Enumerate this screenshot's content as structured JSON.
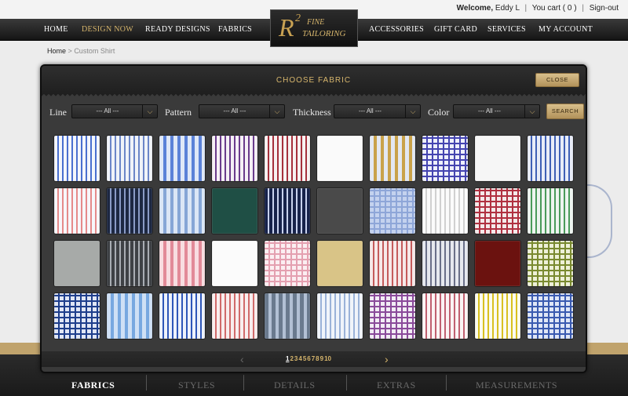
{
  "header": {
    "welcome": "Welcome,",
    "user_name": "Eddy L",
    "separator": "|",
    "cart_label": "You cart",
    "cart_count": "( 0 )",
    "signout": "Sign-out"
  },
  "nav": {
    "items": [
      {
        "label": "HOME"
      },
      {
        "label": "DESIGN NOW",
        "active": true
      },
      {
        "label": "READY DESIGNS"
      },
      {
        "label": "FABRICS"
      },
      {
        "label": "ACCESSORIES"
      },
      {
        "label": "GIFT CARD"
      },
      {
        "label": "SERVICES"
      },
      {
        "label": "MY ACCOUNT"
      }
    ]
  },
  "logo": {
    "letter": "R",
    "sup": "2",
    "line1": "FINE",
    "line2": "TAILORING"
  },
  "breadcrumb": {
    "home": "Home",
    "sep": ">",
    "current": "Custom Shirt"
  },
  "modal": {
    "title": "CHOOSE FABRIC",
    "close_label": "CLOSE",
    "search_label": "SEARCH",
    "filters": [
      {
        "label": "Line",
        "value": "--- All ---"
      },
      {
        "label": "Pattern",
        "value": "--- All ---"
      },
      {
        "label": "Thickness",
        "value": "--- All ---"
      },
      {
        "label": "Color",
        "value": "--- All ---"
      }
    ],
    "pager": {
      "prev": "‹",
      "next": "›",
      "pages": [
        "1",
        "2",
        "3",
        "4",
        "5",
        "6",
        "7",
        "8",
        "9",
        "10"
      ],
      "current": "1"
    },
    "fabrics": [
      {
        "pattern": "stripe",
        "bg": "#f4f6fb",
        "c1": "#4a6fcf"
      },
      {
        "pattern": "stripe",
        "bg": "#f0f3f8",
        "c1": "#6b86c8"
      },
      {
        "pattern": "wstripe",
        "bg": "#dfe8f7",
        "c1": "#5b82d8"
      },
      {
        "pattern": "stripe",
        "bg": "#f5f0f5",
        "c1": "#6a3b8c"
      },
      {
        "pattern": "stripe",
        "bg": "#f7f2f2",
        "c1": "#a5303c"
      },
      {
        "pattern": "solid",
        "bg": "#fafafa",
        "c1": "#fafafa"
      },
      {
        "pattern": "wstripe",
        "bg": "#e3e8f2",
        "c1": "#c9a24a"
      },
      {
        "pattern": "check",
        "bg": "#eef0fb",
        "c1": "#4444b0"
      },
      {
        "pattern": "solid",
        "bg": "#f6f6f6",
        "c1": "#f6f6f6"
      },
      {
        "pattern": "stripe",
        "bg": "#e8ecf7",
        "c1": "#3e5fb5"
      },
      {
        "pattern": "stripe",
        "bg": "#f7f7fb",
        "c1": "#e58a8a"
      },
      {
        "pattern": "stripe",
        "bg": "#1d2842",
        "c1": "#8a9bc6"
      },
      {
        "pattern": "wstripe",
        "bg": "#dbe6f5",
        "c1": "#86a6d6"
      },
      {
        "pattern": "solid",
        "bg": "#1f4f45",
        "c1": "#1f4f45"
      },
      {
        "pattern": "stripe",
        "bg": "#17224a",
        "c1": "#c9d2ee"
      },
      {
        "pattern": "solid",
        "bg": "#4a4a4a",
        "c1": "#4a4a4a"
      },
      {
        "pattern": "check",
        "bg": "#c4d2ee",
        "c1": "#8ea6d8"
      },
      {
        "pattern": "stripe",
        "bg": "#fbfbfb",
        "c1": "#d0d0d0"
      },
      {
        "pattern": "check",
        "bg": "#f4eaea",
        "c1": "#b03040"
      },
      {
        "pattern": "stripe",
        "bg": "#eef4f0",
        "c1": "#4a9a5a"
      },
      {
        "pattern": "solid",
        "bg": "#a7aaa8",
        "c1": "#a7aaa8"
      },
      {
        "pattern": "stripe",
        "bg": "#3e4145",
        "c1": "#a9adb3"
      },
      {
        "pattern": "wstripe",
        "bg": "#f8dde1",
        "c1": "#e28a98"
      },
      {
        "pattern": "solid",
        "bg": "#fbfbfb",
        "c1": "#fbfbfb"
      },
      {
        "pattern": "check",
        "bg": "#fbeef1",
        "c1": "#e4a0b0"
      },
      {
        "pattern": "solid",
        "bg": "#d9c487",
        "c1": "#d9c487"
      },
      {
        "pattern": "stripe",
        "bg": "#f6e8e8",
        "c1": "#c45a5a"
      },
      {
        "pattern": "stripe",
        "bg": "#e6e8ee",
        "c1": "#6a6f88"
      },
      {
        "pattern": "solid",
        "bg": "#6b120f",
        "c1": "#6b120f"
      },
      {
        "pattern": "check",
        "bg": "#eef0d8",
        "c1": "#7a8a30"
      },
      {
        "pattern": "check",
        "bg": "#e0e6f5",
        "c1": "#1e3e8c"
      },
      {
        "pattern": "wstripe",
        "bg": "#cfe0f5",
        "c1": "#78a8e0"
      },
      {
        "pattern": "stripe",
        "bg": "#eef2fb",
        "c1": "#2e56b8"
      },
      {
        "pattern": "stripe",
        "bg": "#f8eeee",
        "c1": "#d06a6a"
      },
      {
        "pattern": "wstripe",
        "bg": "#6a7a8e",
        "c1": "#b2c0d4"
      },
      {
        "pattern": "stripe",
        "bg": "#f0f4fa",
        "c1": "#9ab2d8"
      },
      {
        "pattern": "check",
        "bg": "#f2ecf5",
        "c1": "#8a4a9a"
      },
      {
        "pattern": "stripe",
        "bg": "#fbf4f4",
        "c1": "#c06070"
      },
      {
        "pattern": "stripe",
        "bg": "#fbfbf0",
        "c1": "#d8c020"
      },
      {
        "pattern": "check",
        "bg": "#dfe6f6",
        "c1": "#3a5ab0"
      }
    ]
  },
  "steps": [
    {
      "label": "FABRICS",
      "active": true
    },
    {
      "label": "STYLES"
    },
    {
      "label": "DETAILS"
    },
    {
      "label": "EXTRAS"
    },
    {
      "label": "MEASUREMENTS"
    }
  ]
}
